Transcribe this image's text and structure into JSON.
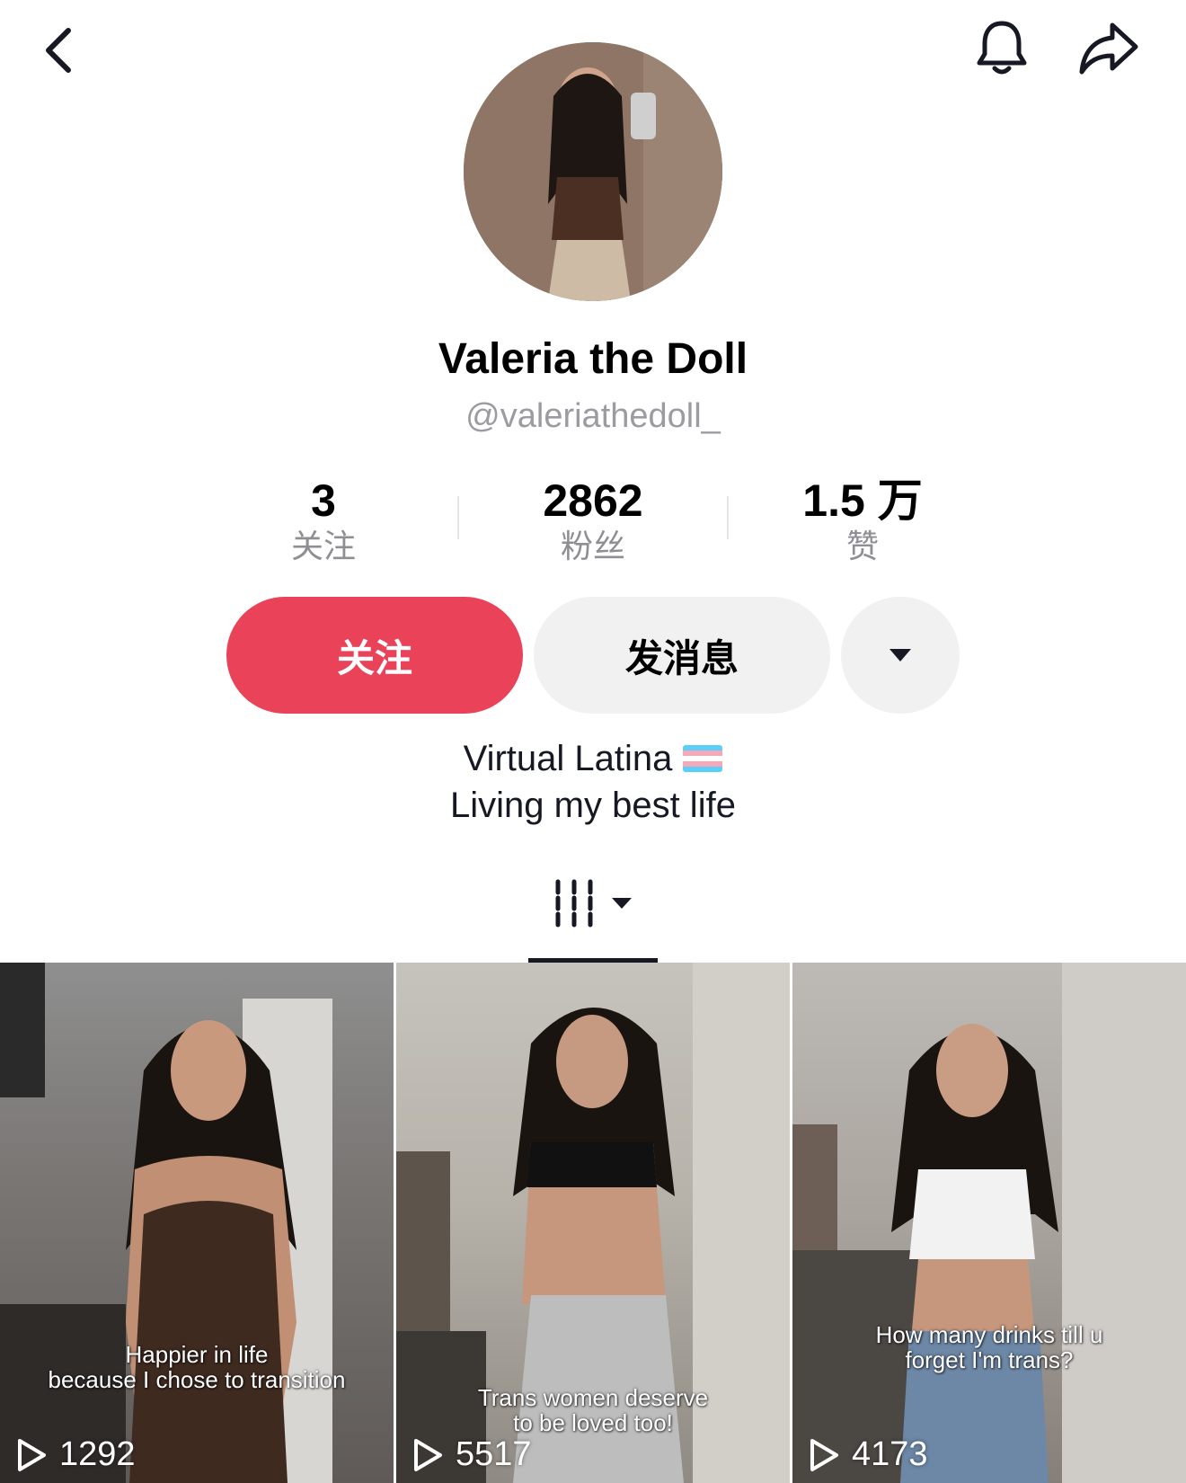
{
  "profile": {
    "display_name": "Valeria the Doll",
    "handle": "@valeriathedoll_"
  },
  "stats": {
    "following_count": "3",
    "following_label": "关注",
    "followers_count": "2862",
    "followers_label": "粉丝",
    "likes_count": "1.5 万",
    "likes_label": "赞"
  },
  "actions": {
    "follow_label": "关注",
    "message_label": "发消息"
  },
  "bio": {
    "line1": "Virtual Latina",
    "line2": "Living my best life"
  },
  "videos": [
    {
      "caption_line1": "Happier in life",
      "caption_line2": "because I chose to transition",
      "plays": "1292"
    },
    {
      "caption_line1": "Trans women deserve",
      "caption_line2": "to be loved too!",
      "plays": "5517"
    },
    {
      "caption_line1": "How many drinks till u",
      "caption_line2": "forget I'm trans?",
      "plays": "4173"
    }
  ],
  "colors": {
    "follow_button": "#ea4359",
    "secondary_button": "#f1f1f2"
  },
  "icons": [
    "chevron-left-icon",
    "bell-icon",
    "share-icon",
    "caret-down-icon",
    "grid-videos-icon",
    "play-icon",
    "trans-flag-icon"
  ]
}
